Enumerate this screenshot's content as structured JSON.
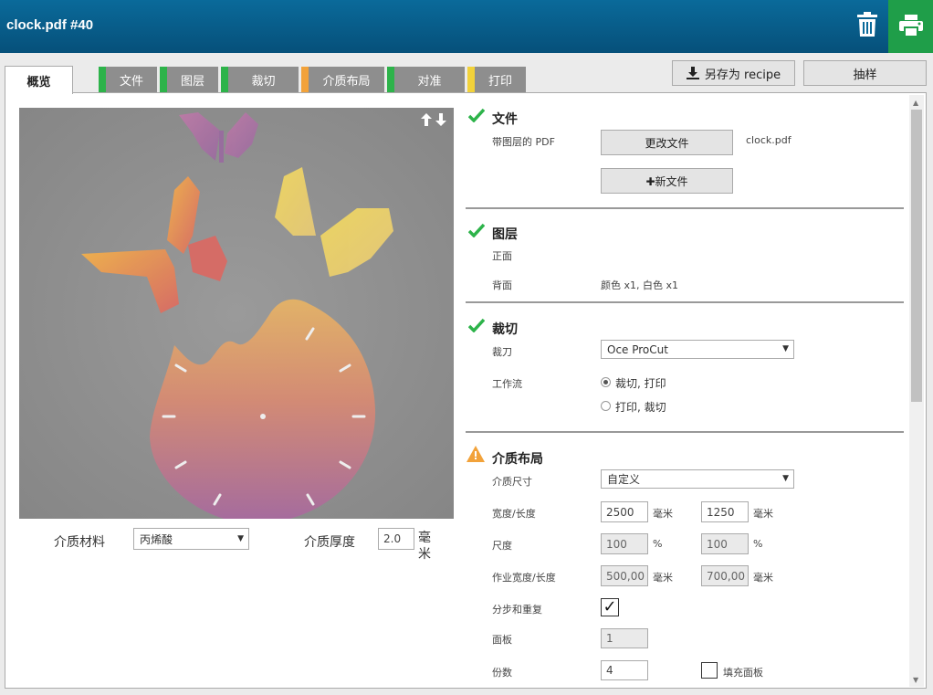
{
  "app": {
    "title": "clock.pdf #40"
  },
  "header": {
    "trash_icon": "trash-icon",
    "print_icon": "printer-icon",
    "print_color": "#1f9e49"
  },
  "tabs": [
    {
      "label": "概览",
      "color": ""
    },
    {
      "label": "文件",
      "color": "#2db34a"
    },
    {
      "label": "图层",
      "color": "#2db34a"
    },
    {
      "label": "裁切",
      "color": "#2db34a"
    },
    {
      "label": "介质布局",
      "color": "#f2a23a"
    },
    {
      "label": "对准",
      "color": "#2db34a"
    },
    {
      "label": "打印",
      "color": "#f2d23a"
    }
  ],
  "toolbar": {
    "save_recipe": "另存为 recipe",
    "sample": "抽样"
  },
  "preview": {
    "arrows": "🡅🡇"
  },
  "media": {
    "material_label": "介质材料",
    "material_value": "丙烯酸",
    "thickness_label": "介质厚度",
    "thickness_value": "2.0",
    "thickness_unit": "毫米"
  },
  "sections": {
    "file": {
      "title": "文件",
      "status": "ok",
      "label": "带图层的 PDF",
      "change_btn": "更改文件",
      "filename": "clock.pdf",
      "new_btn": "✚新文件"
    },
    "layers": {
      "title": "图层",
      "status": "ok",
      "front_label": "正面",
      "back_label": "背面",
      "back_value": "颜色 x1, 白色 x1"
    },
    "cut": {
      "title": "裁切",
      "status": "ok",
      "cutter_label": "裁刀",
      "cutter_value": "Oce ProCut",
      "workflow_label": "工作流",
      "workflow_options": [
        "裁切, 打印",
        "打印, 裁切"
      ],
      "workflow_selected": "裁切, 打印"
    },
    "layout": {
      "title": "介质布局",
      "status": "warning",
      "size_label": "介质尺寸",
      "size_value": "自定义",
      "wl_label": "宽度/长度",
      "width": "2500",
      "length": "1250",
      "unit_mm": "毫米",
      "scale_label": "尺度",
      "scale_x": "100",
      "scale_y": "100",
      "unit_pct": "%",
      "job_label": "作业宽度/长度",
      "job_w": "500,00",
      "job_l": "700,00",
      "step_label": "分步和重复",
      "step_checked": "✓",
      "panels_label": "面板",
      "panels_value": "1",
      "copies_label": "份数",
      "copies_value": "4",
      "fill_label": "填充面板"
    }
  }
}
